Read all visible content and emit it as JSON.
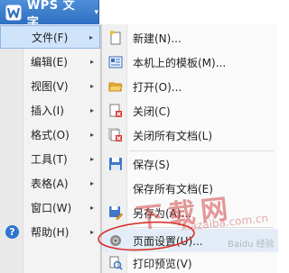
{
  "app_button": {
    "title": "WPS 文字",
    "caret": "▾"
  },
  "main_menu": {
    "items": [
      {
        "label": "文件(F)",
        "arrow": "▸"
      },
      {
        "label": "编辑(E)",
        "arrow": "▸"
      },
      {
        "label": "视图(V)",
        "arrow": "▸"
      },
      {
        "label": "插入(I)",
        "arrow": "▸"
      },
      {
        "label": "格式(O)",
        "arrow": "▸"
      },
      {
        "label": "工具(T)",
        "arrow": "▸"
      },
      {
        "label": "表格(A)",
        "arrow": "▸"
      },
      {
        "label": "窗口(W)",
        "arrow": "▸"
      },
      {
        "label": "帮助(H)",
        "arrow": "▸"
      }
    ]
  },
  "file_submenu": {
    "items": [
      {
        "label": "新建(N)...",
        "icon": "new-document-icon"
      },
      {
        "label": "本机上的模板(M)...",
        "icon": "template-icon"
      },
      {
        "label": "打开(O)...",
        "icon": "open-folder-icon"
      },
      {
        "label": "关闭(C)",
        "icon": "close-document-icon"
      },
      {
        "label": "关闭所有文档(L)",
        "icon": "close-all-documents-icon"
      },
      {
        "label": "保存(S)",
        "icon": "save-icon"
      },
      {
        "label": "保存所有文档(E)",
        "icon": ""
      },
      {
        "label": "另存为(A)...",
        "icon": "save-as-icon"
      },
      {
        "label": "页面设置(U)...",
        "icon": "page-setup-icon"
      },
      {
        "label": "打印预览(V)",
        "icon": "print-preview-icon"
      }
    ]
  },
  "watermark": {
    "big": "下载网",
    "small": "xiazaiba.com.cn",
    "tag": "Baidu 经验"
  },
  "colors": {
    "title_bar": "#2d6fc2",
    "active_menu": "#cfe3fb",
    "annotation": "#d9302c",
    "help_icon": "#2e75cf"
  }
}
